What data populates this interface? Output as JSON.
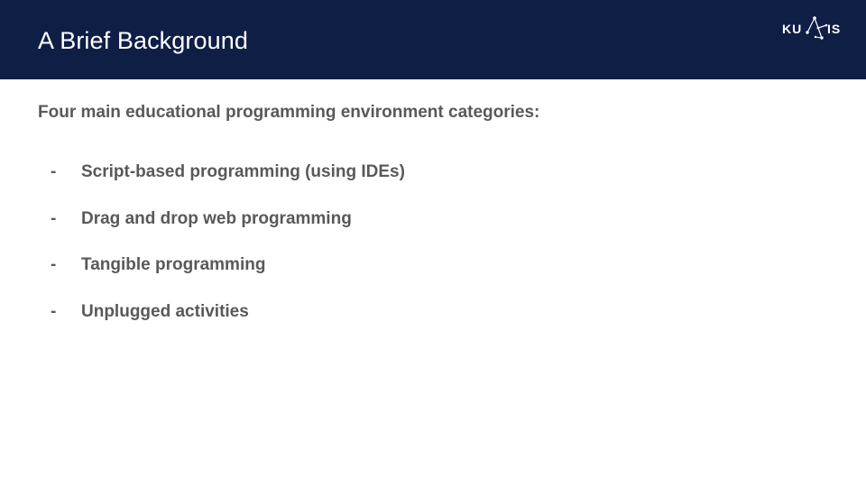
{
  "header": {
    "title": "A Brief Background",
    "background_color": "#0f1e45"
  },
  "logo": {
    "text_left": "KU",
    "text_right": "IS",
    "icon": "constellation-logo-icon"
  },
  "content": {
    "intro": "Four main educational programming environment categories:",
    "bullet_marker": "-",
    "items": [
      "Script-based programming (using IDEs)",
      "Drag and drop web programming",
      "Tangible programming",
      "Unplugged activities"
    ],
    "text_color": "#595959"
  }
}
